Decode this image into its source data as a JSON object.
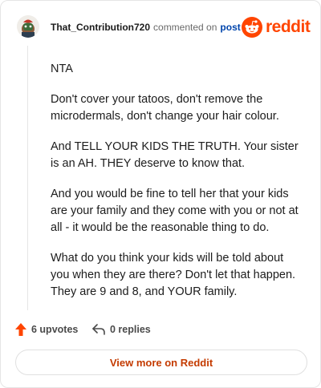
{
  "header": {
    "username": "That_Contribution720",
    "commented_text": "commented on",
    "post_link": "post",
    "brand": "reddit"
  },
  "comment": {
    "paragraphs": [
      "NTA",
      "Don't cover your tatoos, don't remove the microdermals, don't change your hair colour.",
      "And TELL YOUR KIDS THE TRUTH. Your sister is an AH. THEY deserve to know that.",
      "And you would be fine to tell her that your kids are your family and they come with you or not at all - it would be the reasonable thing to do.",
      "What do you think your kids will be told about you when they are there? Don't let that happen. They are 9 and 8, and YOUR family."
    ]
  },
  "actions": {
    "upvotes": "6 upvotes",
    "replies": "0 replies"
  },
  "footer": {
    "view_more": "View more on Reddit"
  },
  "colors": {
    "brand": "#ff4500",
    "link": "#0045ac",
    "button_text": "#c43b00"
  },
  "icons": [
    "avatar",
    "reddit-logo-icon",
    "upvote-arrow-icon",
    "reply-arrow-icon"
  ]
}
